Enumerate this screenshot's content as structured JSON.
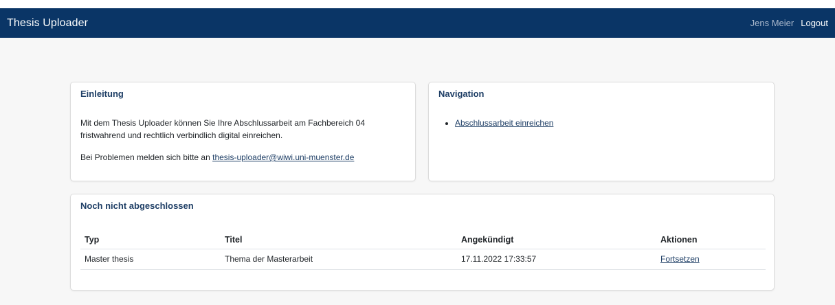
{
  "app": {
    "title": "Thesis Uploader"
  },
  "user": {
    "name": "Jens Meier",
    "logout_label": "Logout"
  },
  "intro_card": {
    "title": "Einleitung",
    "paragraph1": "Mit dem Thesis Uploader können Sie Ihre Abschlussarbeit am Fachbereich 04 fristwahrend und rechtlich verbindlich digital einreichen.",
    "paragraph2_prefix": "Bei Problemen melden sich bitte an ",
    "contact_email": "thesis-uploader@wiwi.uni-muenster.de"
  },
  "nav_card": {
    "title": "Navigation",
    "links": [
      {
        "label": "Abschlussarbeit einreichen"
      }
    ]
  },
  "open_card": {
    "title": "Noch nicht abgeschlossen",
    "columns": [
      "Typ",
      "Titel",
      "Angekündigt",
      "Aktionen"
    ],
    "rows": [
      {
        "type": "Master thesis",
        "title": "Thema der Masterarbeit",
        "announced": "17.11.2022 17:33:57",
        "action": "Fortsetzen"
      }
    ]
  },
  "colors": {
    "navbar_bg": "#0a3566",
    "card_title": "#1f3f66",
    "page_bg": "#f7f7f7"
  }
}
